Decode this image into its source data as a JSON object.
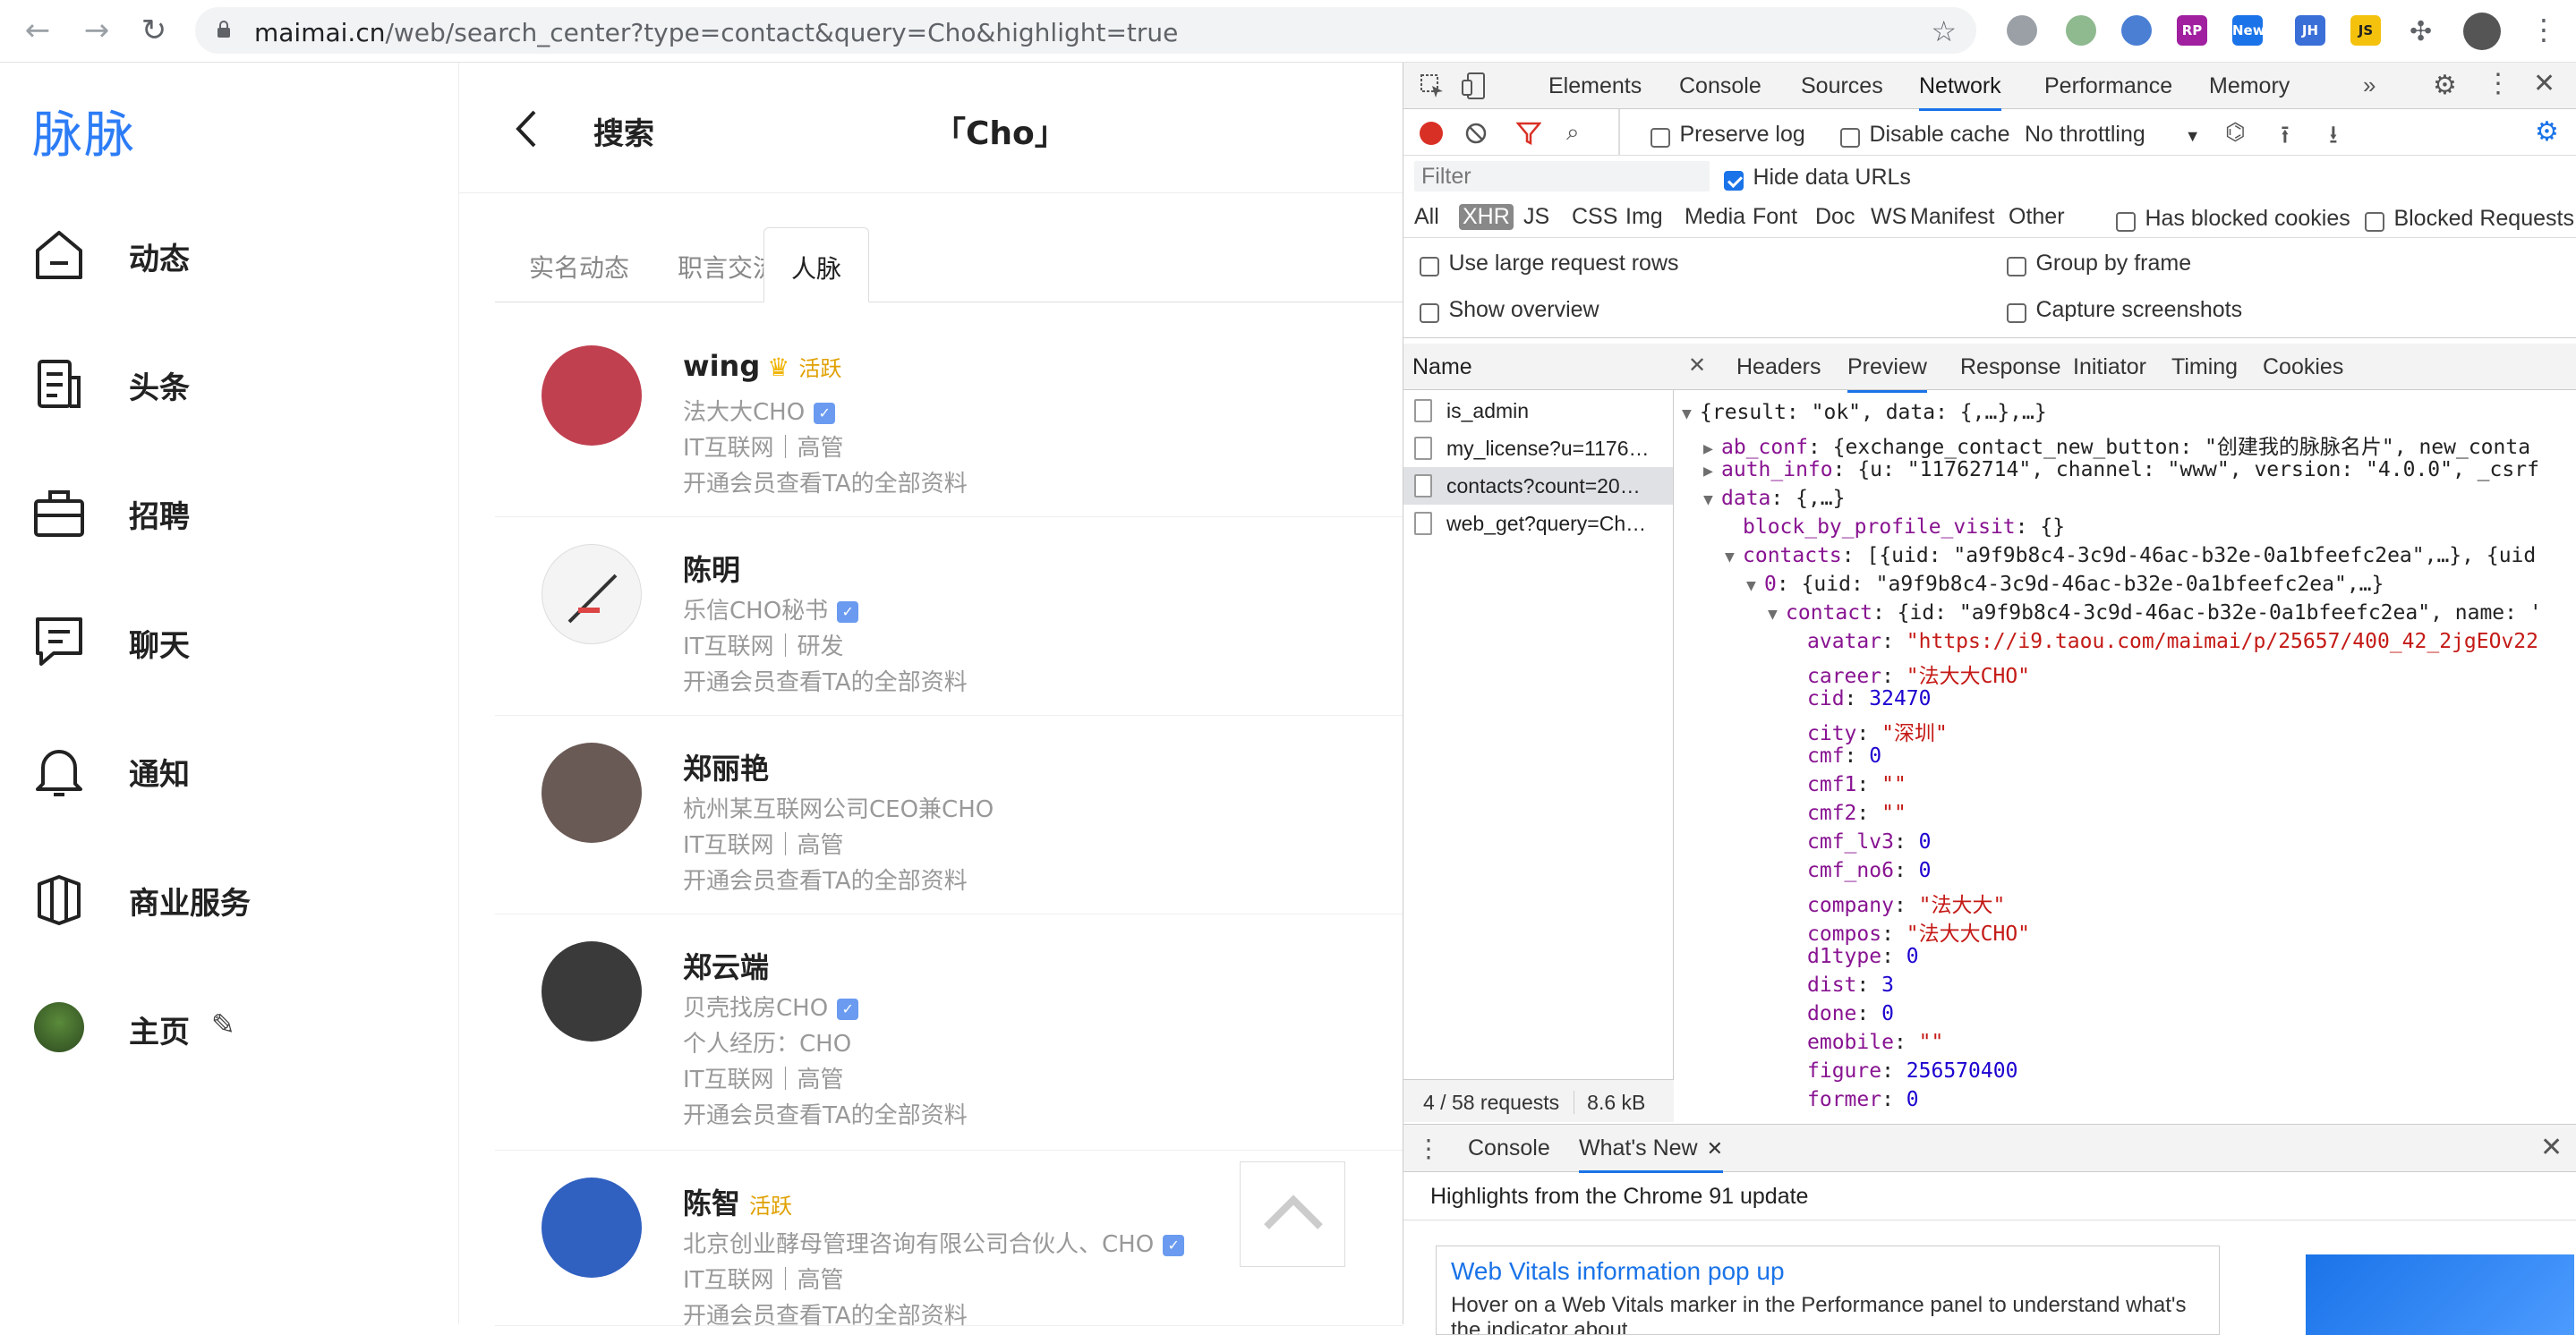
{
  "browser": {
    "url_host": "maimai.cn",
    "url_path": "/web/search_center?type=contact&query=Cho&highlight=true",
    "extensions": [
      {
        "name": "vpn-icon",
        "color": "#9aa0a6",
        "text": ""
      },
      {
        "name": "circle-ext-icon",
        "color": "#8fb98f",
        "text": ""
      },
      {
        "name": "o-ext-icon",
        "color": "#4a7fd4",
        "text": ""
      },
      {
        "name": "rp-ext-icon",
        "color": "#a020a0",
        "text": "RP"
      },
      {
        "name": "new-ext-icon",
        "color": "#1a73e8",
        "text": "New"
      },
      {
        "name": "jh-ext-icon",
        "color": "#3b6fd8",
        "text": "JH"
      },
      {
        "name": "js-ext-icon",
        "color": "#f4c20d",
        "text": "JS"
      }
    ]
  },
  "sidenav": {
    "logo": "脉脉",
    "items": [
      {
        "label": "动态",
        "icon": "home-icon"
      },
      {
        "label": "头条",
        "icon": "article-icon"
      },
      {
        "label": "招聘",
        "icon": "briefcase-icon"
      },
      {
        "label": "聊天",
        "icon": "chat-icon"
      },
      {
        "label": "通知",
        "icon": "bell-icon"
      },
      {
        "label": "商业服务",
        "icon": "business-icon"
      },
      {
        "label": "主页",
        "icon": "avatar"
      }
    ]
  },
  "search": {
    "back_label": "搜索",
    "query_title": "「Cho」",
    "tabs": [
      "实名动态",
      "职言交流",
      "人脉"
    ],
    "active_tab": 2,
    "people": [
      {
        "name": "wing",
        "active": "活跃",
        "crown": true,
        "title": "法大大CHO",
        "verified": true,
        "industry": "IT互联网｜高管",
        "extra": "",
        "cta": "开通会员查看TA的全部资料",
        "avatar_color": "#c04050"
      },
      {
        "name": "陈明",
        "active": "",
        "crown": false,
        "title": "乐信CHO秘书",
        "verified": true,
        "industry": "IT互联网｜研发",
        "extra": "",
        "cta": "开通会员查看TA的全部资料",
        "avatar_color": "#f4f4f4"
      },
      {
        "name": "郑丽艳",
        "active": "",
        "crown": false,
        "title": "杭州某互联网公司CEO兼CHO",
        "verified": false,
        "industry": "IT互联网｜高管",
        "extra": "",
        "cta": "开通会员查看TA的全部资料",
        "avatar_color": "#6a5a55"
      },
      {
        "name": "郑云端",
        "active": "",
        "crown": false,
        "title": "贝壳找房CHO",
        "verified": true,
        "industry": "IT互联网｜高管",
        "extra": "个人经历：CHO",
        "cta": "开通会员查看TA的全部资料",
        "avatar_color": "#3a3a3a"
      },
      {
        "name": "陈智",
        "active": "活跃",
        "crown": false,
        "title": "北京创业酵母管理咨询有限公司合伙人、CHO",
        "verified": true,
        "industry": "IT互联网｜高管",
        "extra": "",
        "cta": "开通会员查看TA的全部资料",
        "avatar_color": "#3060c0"
      }
    ]
  },
  "devtools": {
    "tabs": [
      "Elements",
      "Console",
      "Sources",
      "Network",
      "Performance",
      "Memory"
    ],
    "active_tab": "Network",
    "toolbar": {
      "preserve_log": "Preserve log",
      "disable_cache": "Disable cache",
      "throttling": "No throttling"
    },
    "filter_placeholder": "Filter",
    "hide_data_urls": "Hide data URLs",
    "type_filters": [
      "All",
      "XHR",
      "JS",
      "CSS",
      "Img",
      "Media",
      "Font",
      "Doc",
      "WS",
      "Manifest",
      "Other"
    ],
    "active_type": "XHR",
    "has_blocked_cookies": "Has blocked cookies",
    "blocked_requests": "Blocked Requests",
    "options": {
      "large_rows": "Use large request rows",
      "show_overview": "Show overview",
      "group_by_frame": "Group by frame",
      "capture_screenshots": "Capture screenshots"
    },
    "name_header": "Name",
    "requests": [
      "is_admin",
      "my_license?u=1176…",
      "contacts?count=20…",
      "web_get?query=Ch…"
    ],
    "selected_request": 2,
    "status_requests": "4 / 58 requests",
    "status_size": "8.6 kB",
    "detail_tabs": [
      "Headers",
      "Preview",
      "Response",
      "Initiator",
      "Timing",
      "Cookies"
    ],
    "active_detail_tab": "Preview",
    "preview_lines": [
      {
        "indent": 0,
        "tri": "▼",
        "key": "",
        "text": "{result: \"ok\", data: {,…},…}",
        "type": "plain"
      },
      {
        "indent": 1,
        "tri": "▶",
        "key": "ab_conf",
        "text": "{exchange_contact_new_button: \"创建我的脉脉名片\", new_conta",
        "type": "obj"
      },
      {
        "indent": 1,
        "tri": "▶",
        "key": "auth_info",
        "text": "{u: \"11762714\", channel: \"www\", version: \"4.0.0\", _csrf",
        "type": "obj"
      },
      {
        "indent": 1,
        "tri": "▼",
        "key": "data",
        "text": "{,…}",
        "type": "obj"
      },
      {
        "indent": 2,
        "tri": "",
        "key": "block_by_profile_visit",
        "text": "{}",
        "type": "obj"
      },
      {
        "indent": 2,
        "tri": "▼",
        "key": "contacts",
        "text": "[{uid: \"a9f9b8c4-3c9d-46ac-b32e-0a1bfeefc2ea\",…}, {uid",
        "type": "obj"
      },
      {
        "indent": 3,
        "tri": "▼",
        "key": "0",
        "text": "{uid: \"a9f9b8c4-3c9d-46ac-b32e-0a1bfeefc2ea\",…}",
        "type": "obj"
      },
      {
        "indent": 4,
        "tri": "▼",
        "key": "contact",
        "text": "{id: \"a9f9b8c4-3c9d-46ac-b32e-0a1bfeefc2ea\", name: '",
        "type": "obj"
      },
      {
        "indent": 5,
        "tri": "",
        "key": "avatar",
        "text": "\"https://i9.taou.com/maimai/p/25657/400_42_2jgEOv22",
        "type": "str"
      },
      {
        "indent": 5,
        "tri": "",
        "key": "career",
        "text": "\"法大大CHO\"",
        "type": "str"
      },
      {
        "indent": 5,
        "tri": "",
        "key": "cid",
        "text": "32470",
        "type": "num"
      },
      {
        "indent": 5,
        "tri": "",
        "key": "city",
        "text": "\"深圳\"",
        "type": "str"
      },
      {
        "indent": 5,
        "tri": "",
        "key": "cmf",
        "text": "0",
        "type": "num"
      },
      {
        "indent": 5,
        "tri": "",
        "key": "cmf1",
        "text": "\"\"",
        "type": "str"
      },
      {
        "indent": 5,
        "tri": "",
        "key": "cmf2",
        "text": "\"\"",
        "type": "str"
      },
      {
        "indent": 5,
        "tri": "",
        "key": "cmf_lv3",
        "text": "0",
        "type": "num"
      },
      {
        "indent": 5,
        "tri": "",
        "key": "cmf_no6",
        "text": "0",
        "type": "num"
      },
      {
        "indent": 5,
        "tri": "",
        "key": "company",
        "text": "\"法大大\"",
        "type": "str"
      },
      {
        "indent": 5,
        "tri": "",
        "key": "compos",
        "text": "\"法大大CHO\"",
        "type": "str"
      },
      {
        "indent": 5,
        "tri": "",
        "key": "d1type",
        "text": "0",
        "type": "num"
      },
      {
        "indent": 5,
        "tri": "",
        "key": "dist",
        "text": "3",
        "type": "num"
      },
      {
        "indent": 5,
        "tri": "",
        "key": "done",
        "text": "0",
        "type": "num"
      },
      {
        "indent": 5,
        "tri": "",
        "key": "emobile",
        "text": "\"\"",
        "type": "str"
      },
      {
        "indent": 5,
        "tri": "",
        "key": "figure",
        "text": "256570400",
        "type": "num"
      },
      {
        "indent": 5,
        "tri": "",
        "key": "former",
        "text": "0",
        "type": "num"
      }
    ],
    "drawer_tabs": [
      "Console",
      "What's New"
    ],
    "active_drawer_tab": "What's New",
    "whatsnew_heading": "Highlights from the Chrome 91 update",
    "card_title": "Web Vitals information pop up",
    "card_text": "Hover on a Web Vitals marker in the Performance panel to understand what's the indicator about."
  }
}
